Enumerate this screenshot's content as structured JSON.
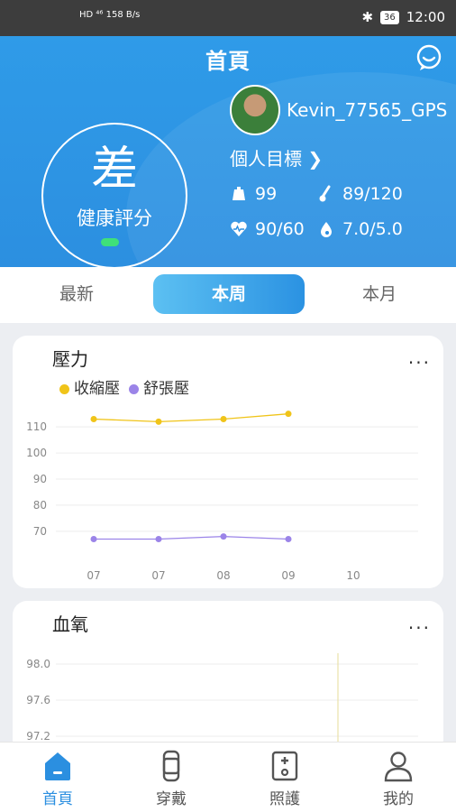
{
  "status_bar": {
    "network": "HD ⁴⁶ 158 B/s",
    "time": "12:00",
    "battery": "36"
  },
  "header": {
    "title": "首頁",
    "score_value": "差",
    "score_label": "健康評分",
    "username": "Kevin_77565_GPS",
    "goal_label": "個人目標",
    "stats": {
      "weight": "99",
      "blood_sugar": "89/120",
      "heart": "90/60",
      "blood": "7.0/5.0"
    }
  },
  "tabs": [
    {
      "label": "最新"
    },
    {
      "label": "本周"
    },
    {
      "label": "本月"
    }
  ],
  "active_tab": "本周",
  "pressure_card": {
    "title": "壓力",
    "more": "..."
  },
  "oxygen_card": {
    "title": "血氧",
    "more": "..."
  },
  "chart_data": [
    {
      "type": "line",
      "title": "壓力",
      "x": [
        "07",
        "07",
        "08",
        "09",
        "10"
      ],
      "x_tick_count": 5,
      "series": [
        {
          "name": "收縮壓",
          "color": "#f0c419",
          "values": [
            113,
            112,
            113,
            115
          ]
        },
        {
          "name": "舒張壓",
          "color": "#9b84e8",
          "values": [
            67,
            67,
            68,
            67
          ]
        }
      ],
      "y_ticks": [
        70,
        80,
        90,
        100,
        110
      ],
      "ylim": [
        62,
        118
      ],
      "grid": true,
      "legend": "top-left"
    },
    {
      "type": "line",
      "title": "血氧",
      "y_ticks": [
        "97.2",
        "97.6",
        "98.0"
      ],
      "ylim": [
        97.0,
        98.2
      ],
      "grid": true
    }
  ],
  "bottom_nav": [
    {
      "label": "首頁",
      "icon": "home-icon"
    },
    {
      "label": "穿戴",
      "icon": "watch-icon"
    },
    {
      "label": "照護",
      "icon": "care-device-icon"
    },
    {
      "label": "我的",
      "icon": "person-icon"
    }
  ],
  "colors": {
    "primary": "#2c8fe0",
    "systolic": "#f0c419",
    "diastolic": "#9b84e8",
    "score_indicator": "#3fe07a"
  }
}
